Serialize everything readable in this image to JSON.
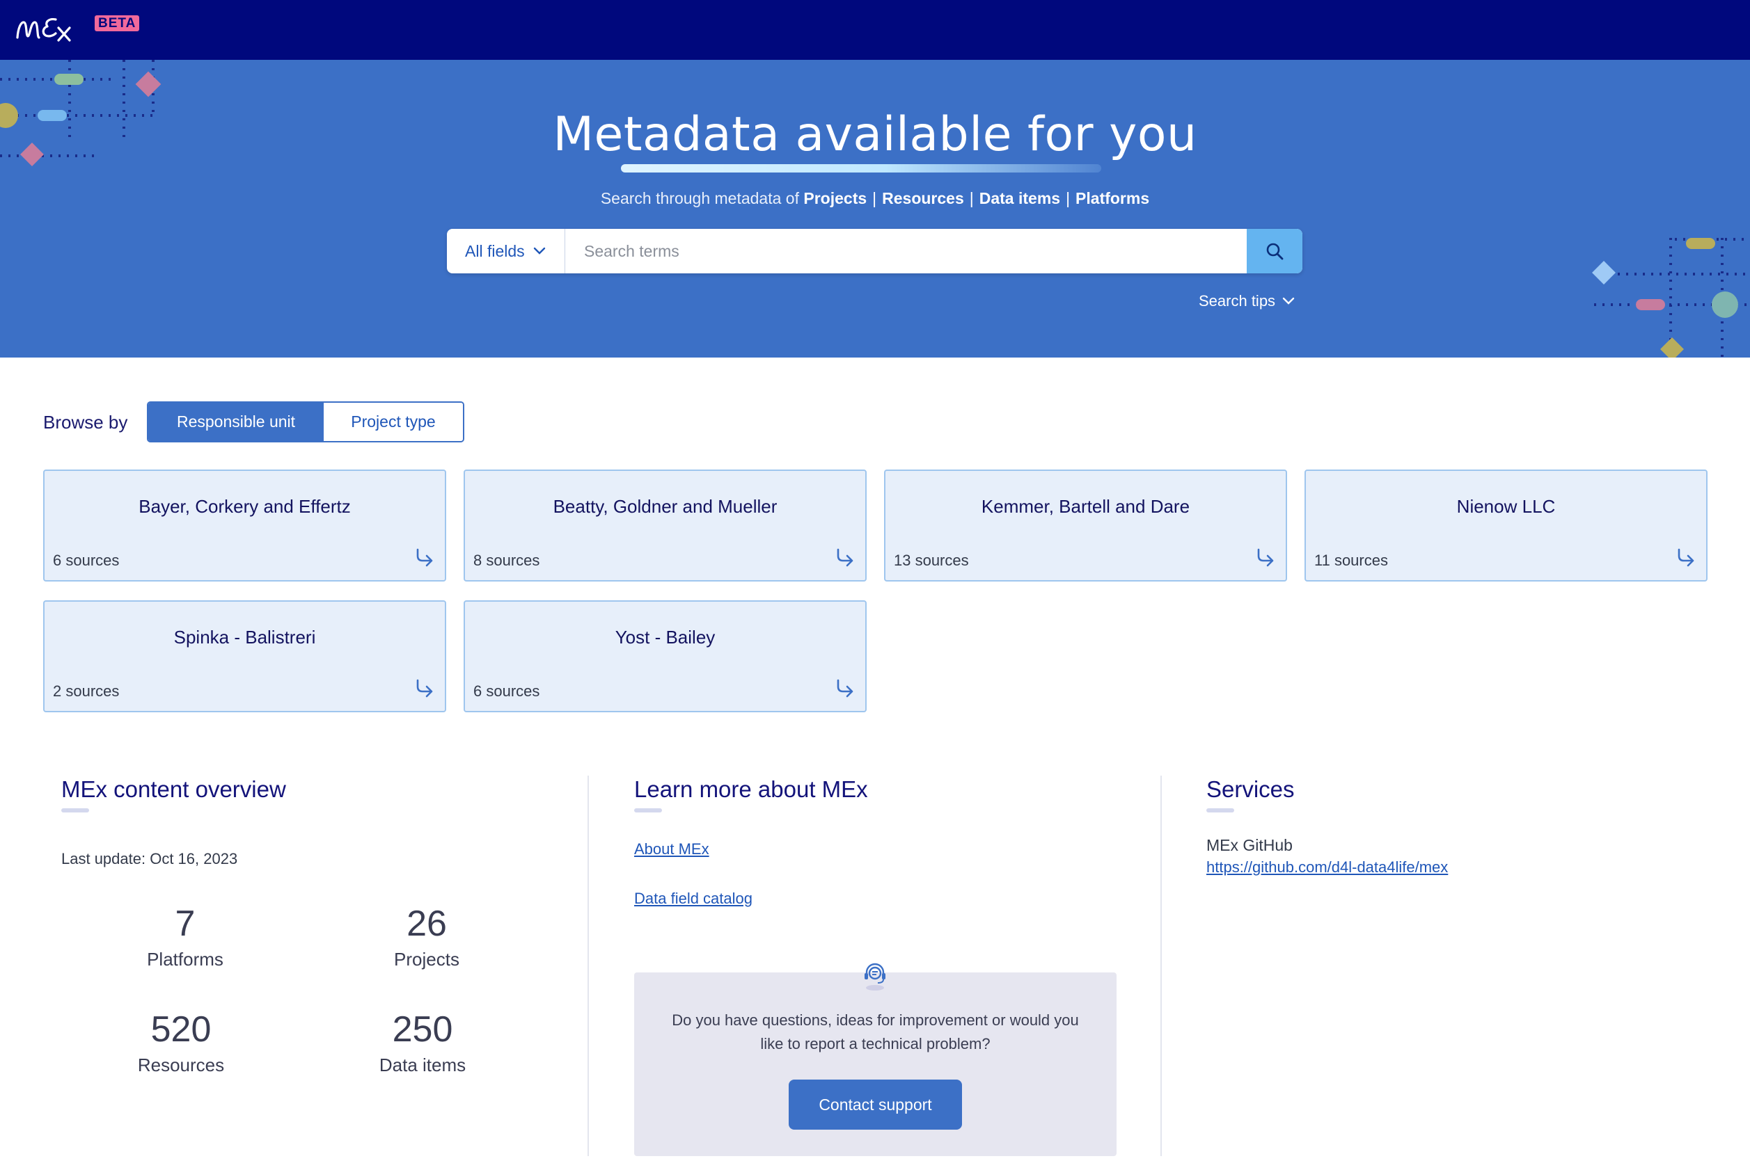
{
  "header": {
    "logo_icon": "mex-logo-icon",
    "beta_badge": "BETA",
    "colors": {
      "bar": "#00087d",
      "badge": "#f0699b"
    }
  },
  "hero": {
    "title": "Metadata available for you",
    "subtitle_prefix": "Search through metadata of",
    "entities": [
      "Projects",
      "Resources",
      "Data items",
      "Platforms"
    ],
    "separator": "|",
    "search": {
      "field_selector": "All fields",
      "placeholder": "Search terms",
      "value": "",
      "button_icon": "search-icon"
    },
    "search_tips": "Search tips",
    "colors": {
      "background": "#3c70c6",
      "search_button": "#64b4f0"
    }
  },
  "browse": {
    "label": "Browse by",
    "tabs": [
      {
        "label": "Responsible unit",
        "active": true
      },
      {
        "label": "Project type",
        "active": false
      }
    ],
    "cards": [
      {
        "name": "Bayer, Corkery and Effertz",
        "count": "6 sources"
      },
      {
        "name": "Beatty, Goldner and Mueller",
        "count": "8 sources"
      },
      {
        "name": "Kemmer, Bartell and Dare",
        "count": "13 sources"
      },
      {
        "name": "Nienow LLC",
        "count": "11 sources"
      },
      {
        "name": "Spinka - Balistreri",
        "count": "2 sources"
      },
      {
        "name": "Yost - Bailey",
        "count": "6 sources"
      }
    ]
  },
  "overview": {
    "title": "MEx content overview",
    "last_update": "Last update: Oct 16, 2023",
    "stats": [
      {
        "value": "7",
        "label": "Platforms"
      },
      {
        "value": "26",
        "label": "Projects"
      },
      {
        "value": "520",
        "label": "Resources"
      },
      {
        "value": "250",
        "label": "Data items"
      }
    ]
  },
  "learn": {
    "title": "Learn more about MEx",
    "links": [
      "About MEx",
      "Data field catalog"
    ],
    "support": {
      "icon": "headset-support-icon",
      "text": "Do you have questions, ideas for improvement or would you like to report a technical problem?",
      "button": "Contact support"
    }
  },
  "services": {
    "title": "Services",
    "items": [
      {
        "label": "MEx GitHub",
        "url": "https://github.com/d4l-data4life/mex"
      }
    ]
  }
}
